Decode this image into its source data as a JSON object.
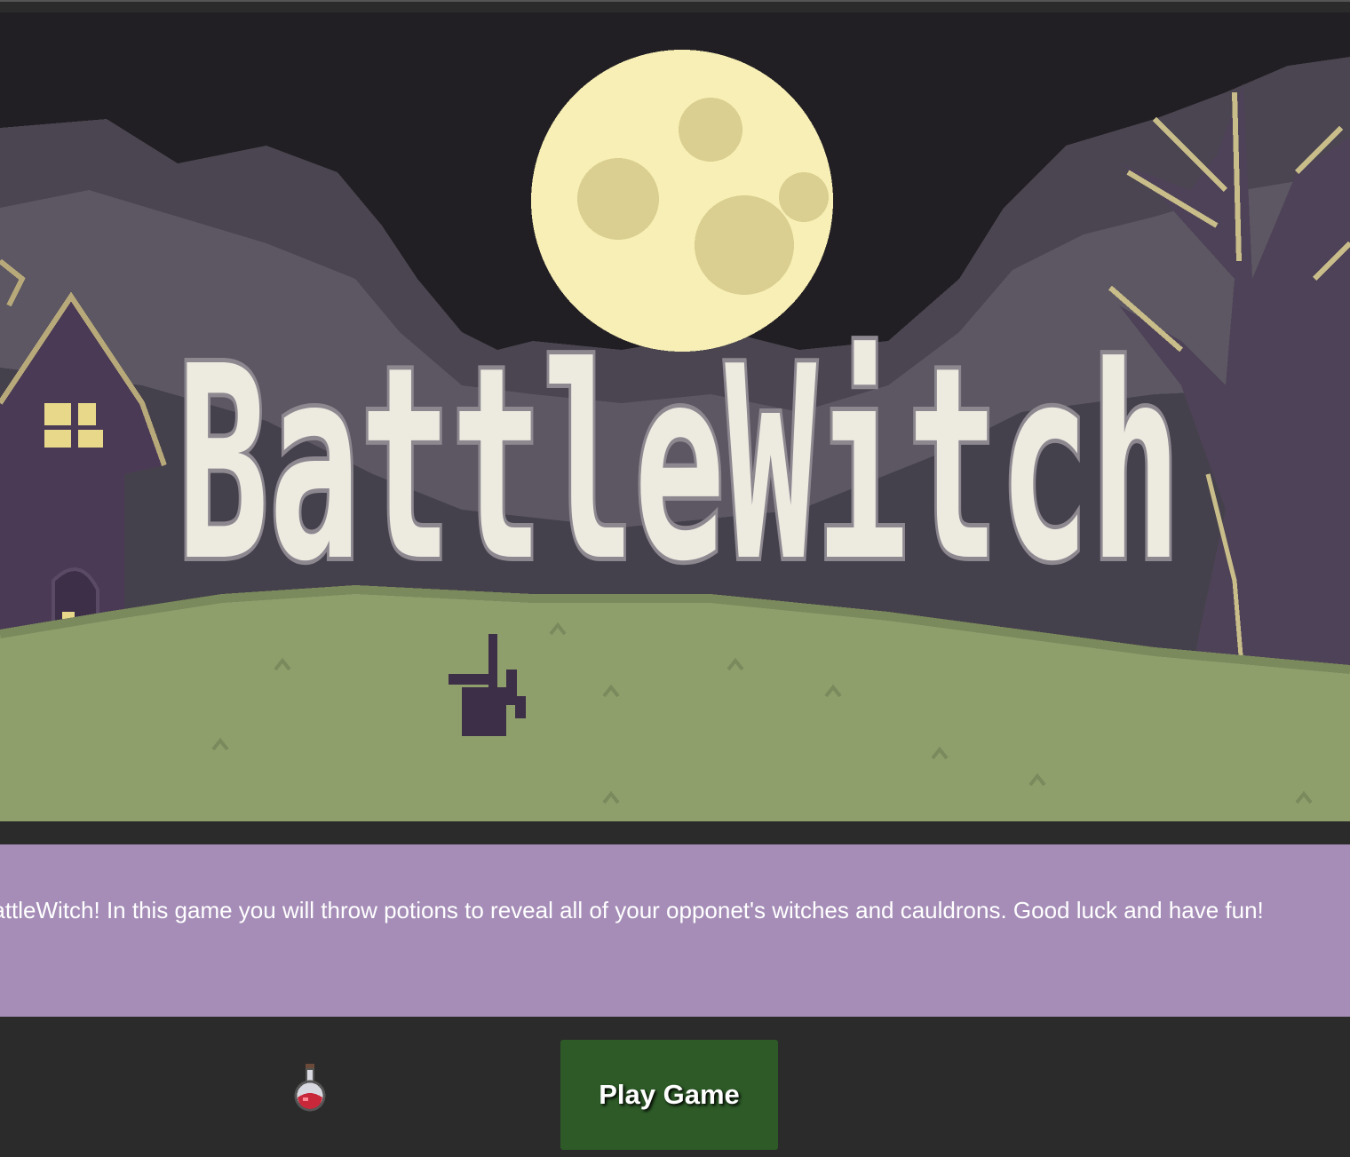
{
  "banner": {
    "title": "BattleWitch"
  },
  "intro": {
    "text": "Welcome to BattleWitch! In this game you will throw potions to reveal all of your opponet's witches and cauldrons. Good luck and have fun!"
  },
  "actions": {
    "play_label": "Play Game"
  },
  "icons": {
    "potion": "potion-icon"
  },
  "colors": {
    "sky": "#221f24",
    "moon": "#f7efb5",
    "grass": "#8f9f6c",
    "intro_bg": "#a58db7",
    "play_button": "#2d5a27",
    "page_bg": "#2b2b2b"
  }
}
